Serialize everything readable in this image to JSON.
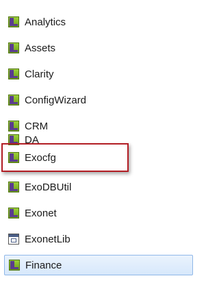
{
  "tree": {
    "items": [
      {
        "label": "Analytics",
        "icon": "project-icon"
      },
      {
        "label": "Assets",
        "icon": "project-icon"
      },
      {
        "label": "Clarity",
        "icon": "project-icon"
      },
      {
        "label": "ConfigWizard",
        "icon": "project-icon"
      },
      {
        "label": "CRM",
        "icon": "project-icon"
      },
      {
        "label": "DA",
        "icon": "project-icon"
      },
      {
        "label": "Exocfg",
        "icon": "project-icon",
        "highlighted": true
      },
      {
        "label": "ExoDBUtil",
        "icon": "project-icon"
      },
      {
        "label": "Exonet",
        "icon": "project-icon"
      },
      {
        "label": "ExonetLib",
        "icon": "library-icon"
      },
      {
        "label": "Finance",
        "icon": "project-icon",
        "selected": true
      }
    ]
  },
  "colors": {
    "highlight_border": "#b21d24",
    "selection_background": "#d7e8fb",
    "selection_border": "#8fb7e8"
  }
}
